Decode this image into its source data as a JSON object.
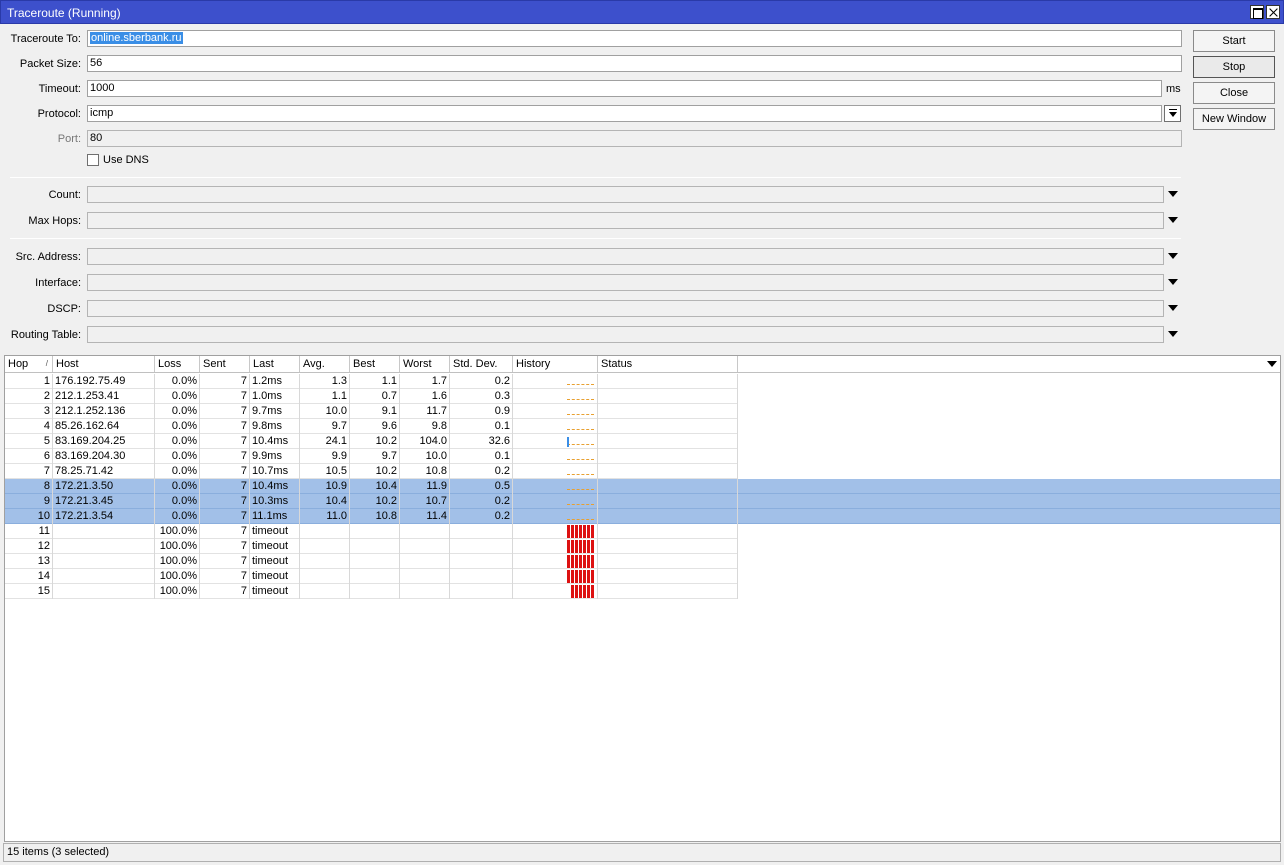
{
  "window": {
    "title": "Traceroute (Running)"
  },
  "form": {
    "traceroute_to_label": "Traceroute To:",
    "traceroute_to_value": "online.sberbank.ru",
    "packet_size_label": "Packet Size:",
    "packet_size_value": "56",
    "timeout_label": "Timeout:",
    "timeout_value": "1000",
    "timeout_unit": "ms",
    "protocol_label": "Protocol:",
    "protocol_value": "icmp",
    "port_label": "Port:",
    "port_value": "80",
    "use_dns_label": "Use DNS",
    "count_label": "Count:",
    "max_hops_label": "Max Hops:",
    "src_address_label": "Src. Address:",
    "interface_label": "Interface:",
    "dscp_label": "DSCP:",
    "routing_table_label": "Routing Table:"
  },
  "buttons": {
    "start": "Start",
    "stop": "Stop",
    "close": "Close",
    "new_window": "New Window"
  },
  "table": {
    "columns": [
      "Hop",
      "Host",
      "Loss",
      "Sent",
      "Last",
      "Avg.",
      "Best",
      "Worst",
      "Std. Dev.",
      "History",
      "Status"
    ],
    "sort_indicator": "/",
    "rows": [
      {
        "hop": "1",
        "host": "176.192.75.49",
        "loss": "0.0%",
        "sent": "7",
        "last": "1.2ms",
        "avg": "1.3",
        "best": "1.1",
        "worst": "1.7",
        "stdev": "0.2",
        "status": "",
        "history": "ok",
        "selected": false
      },
      {
        "hop": "2",
        "host": "212.1.253.41",
        "loss": "0.0%",
        "sent": "7",
        "last": "1.0ms",
        "avg": "1.1",
        "best": "0.7",
        "worst": "1.6",
        "stdev": "0.3",
        "status": "",
        "history": "ok",
        "selected": false
      },
      {
        "hop": "3",
        "host": "212.1.252.136",
        "loss": "0.0%",
        "sent": "7",
        "last": "9.7ms",
        "avg": "10.0",
        "best": "9.1",
        "worst": "11.7",
        "stdev": "0.9",
        "status": "",
        "history": "ok",
        "selected": false
      },
      {
        "hop": "4",
        "host": "85.26.162.64",
        "loss": "0.0%",
        "sent": "7",
        "last": "9.8ms",
        "avg": "9.7",
        "best": "9.6",
        "worst": "9.8",
        "stdev": "0.1",
        "status": "",
        "history": "ok",
        "selected": false
      },
      {
        "hop": "5",
        "host": "83.169.204.25",
        "loss": "0.0%",
        "sent": "7",
        "last": "10.4ms",
        "avg": "24.1",
        "best": "10.2",
        "worst": "104.0",
        "stdev": "32.6",
        "status": "",
        "history": "spike",
        "selected": false
      },
      {
        "hop": "6",
        "host": "83.169.204.30",
        "loss": "0.0%",
        "sent": "7",
        "last": "9.9ms",
        "avg": "9.9",
        "best": "9.7",
        "worst": "10.0",
        "stdev": "0.1",
        "status": "",
        "history": "ok",
        "selected": false
      },
      {
        "hop": "7",
        "host": "78.25.71.42",
        "loss": "0.0%",
        "sent": "7",
        "last": "10.7ms",
        "avg": "10.5",
        "best": "10.2",
        "worst": "10.8",
        "stdev": "0.2",
        "status": "",
        "history": "ok",
        "selected": false
      },
      {
        "hop": "8",
        "host": "172.21.3.50",
        "loss": "0.0%",
        "sent": "7",
        "last": "10.4ms",
        "avg": "10.9",
        "best": "10.4",
        "worst": "11.9",
        "stdev": "0.5",
        "status": "",
        "history": "ok",
        "selected": true
      },
      {
        "hop": "9",
        "host": "172.21.3.45",
        "loss": "0.0%",
        "sent": "7",
        "last": "10.3ms",
        "avg": "10.4",
        "best": "10.2",
        "worst": "10.7",
        "stdev": "0.2",
        "status": "",
        "history": "ok",
        "selected": true
      },
      {
        "hop": "10",
        "host": "172.21.3.54",
        "loss": "0.0%",
        "sent": "7",
        "last": "11.1ms",
        "avg": "11.0",
        "best": "10.8",
        "worst": "11.4",
        "stdev": "0.2",
        "status": "",
        "history": "ok",
        "selected": true
      },
      {
        "hop": "11",
        "host": "",
        "loss": "100.0%",
        "sent": "7",
        "last": "timeout",
        "avg": "",
        "best": "",
        "worst": "",
        "stdev": "",
        "status": "",
        "history": "loss",
        "selected": false
      },
      {
        "hop": "12",
        "host": "",
        "loss": "100.0%",
        "sent": "7",
        "last": "timeout",
        "avg": "",
        "best": "",
        "worst": "",
        "stdev": "",
        "status": "",
        "history": "loss",
        "selected": false
      },
      {
        "hop": "13",
        "host": "",
        "loss": "100.0%",
        "sent": "7",
        "last": "timeout",
        "avg": "",
        "best": "",
        "worst": "",
        "stdev": "",
        "status": "",
        "history": "loss",
        "selected": false
      },
      {
        "hop": "14",
        "host": "",
        "loss": "100.0%",
        "sent": "7",
        "last": "timeout",
        "avg": "",
        "best": "",
        "worst": "",
        "stdev": "",
        "status": "",
        "history": "loss",
        "selected": false
      },
      {
        "hop": "15",
        "host": "",
        "loss": "100.0%",
        "sent": "7",
        "last": "timeout",
        "avg": "",
        "best": "",
        "worst": "",
        "stdev": "",
        "status": "",
        "history": "loss-short",
        "selected": false
      }
    ]
  },
  "statusbar": {
    "text": "15 items (3 selected)"
  },
  "colors": {
    "titlebar": "#3d50cc",
    "selection": "#a2c0e8",
    "loss_bar": "#dd1111",
    "latency_dash": "#e8a030",
    "latency_spike": "#3a8ee6"
  }
}
